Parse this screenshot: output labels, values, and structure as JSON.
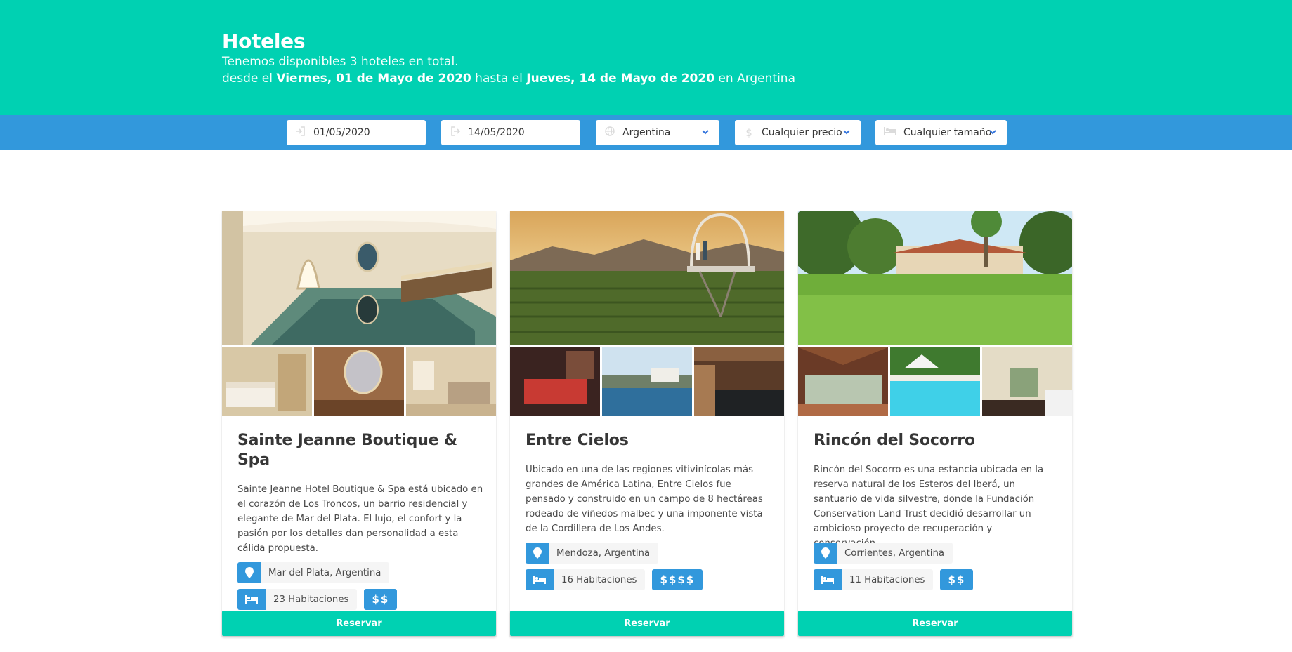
{
  "hero": {
    "title": "Hoteles",
    "line1": "Tenemos disponibles 3 hoteles en total.",
    "line2_prefix": "desde el ",
    "date_from": "Viernes, 01 de Mayo de 2020",
    "line2_mid": " hasta el ",
    "date_to": "Jueves, 14 de Mayo de 2020",
    "line2_suffix": " en Argentina"
  },
  "filters": {
    "date_from": "01/05/2020",
    "date_to": "14/05/2020",
    "country": "Argentina",
    "price": "Cualquier precio",
    "size": "Cualquier tamaño",
    "icons": [
      "sign-in-icon",
      "sign-out-icon",
      "globe-icon",
      "dollar-icon",
      "bed-icon"
    ]
  },
  "hotels": [
    {
      "name": "Sainte Jeanne Boutique & Spa",
      "description": "Sainte Jeanne Hotel Boutique & Spa está ubicado en el corazón de Los Troncos, un barrio residencial y elegante de Mar del Plata. El lujo, el confort y la pasión por los detalles dan personalidad a esta cálida propuesta.",
      "location": "Mar del Plata, Argentina",
      "rooms": "23 Habitaciones",
      "price": "$$",
      "button": "Reservar"
    },
    {
      "name": "Entre Cielos",
      "description": "Ubicado en una de las regiones vitivinícolas más grandes de América Latina, Entre Cielos fue pensado y construido en un campo de 8 hectáreas rodeado de viñedos malbec y una imponente vista de la Cordillera de Los Andes.",
      "location": "Mendoza, Argentina",
      "rooms": "16 Habitaciones",
      "price": "$$$$",
      "button": "Reservar"
    },
    {
      "name": "Rincón del Socorro",
      "description": "Rincón del Socorro es una estancia ubicada en la reserva natural de los Esteros del Iberá, un santuario de vida silvestre, donde la Fundación Conservation Land Trust decidió desarrollar un ambicioso proyecto de recuperación y conservación.",
      "location": "Corrientes, Argentina",
      "rooms": "11 Habitaciones",
      "price": "$$",
      "button": "Reservar"
    }
  ],
  "colors": {
    "primary": "#00d1b2",
    "info": "#3298dc"
  }
}
